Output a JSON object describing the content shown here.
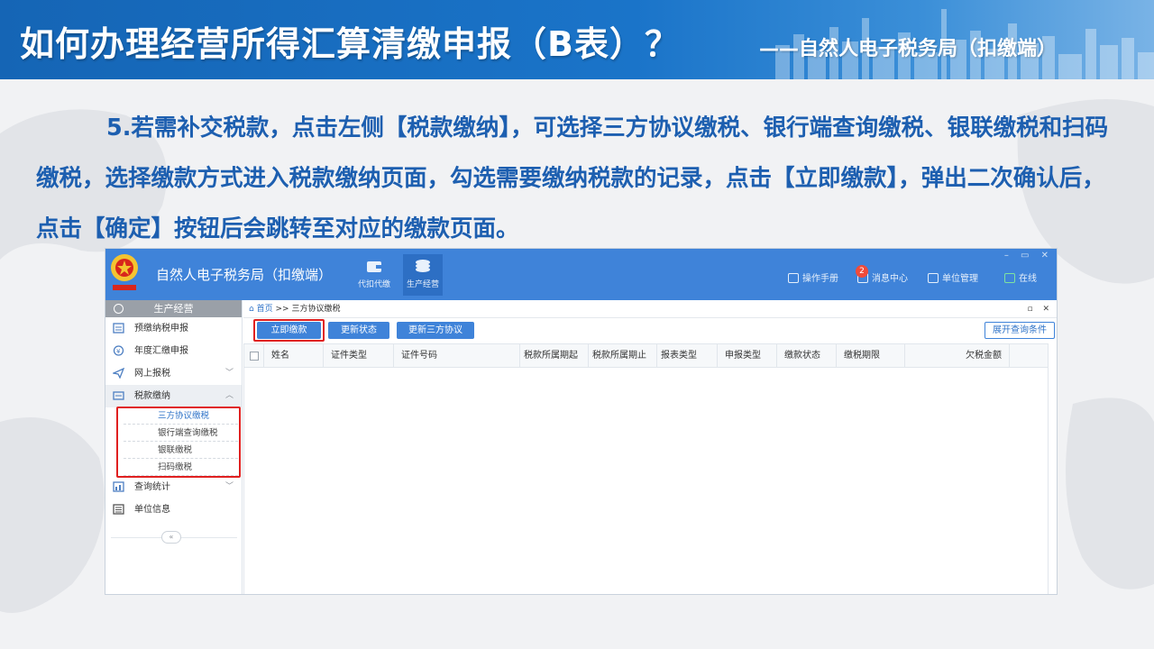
{
  "slide": {
    "title": "如何办理经营所得汇算清缴申报（B表）？",
    "subtitle": "——自然人电子税务局（扣缴端）",
    "instruction": "5.若需补交税款，点击左侧【税款缴纳】，可选择三方协议缴税、银行端查询缴税、银联缴税和扫码缴税，选择缴款方式进入税款缴纳页面，勾选需要缴纳税款的记录，点击【立即缴款】，弹出二次确认后，点击【确定】按钮后会跳转至对应的缴款页面。"
  },
  "app": {
    "name": "自然人电子税务局（扣缴端）",
    "top_nav": [
      {
        "label": "代扣代缴",
        "icon": "wallet-icon"
      },
      {
        "label": "生产经营",
        "icon": "coins-icon"
      }
    ],
    "top_right": {
      "manual": "操作手册",
      "messages": "消息中心",
      "message_count": "2",
      "unit_mgmt": "单位管理",
      "online": "在线"
    },
    "window_controls": "– ▭ ✕",
    "sidebar": {
      "header": "生产经营",
      "items": [
        {
          "label": "预缴纳税申报",
          "icon": "form-icon"
        },
        {
          "label": "年度汇缴申报",
          "icon": "yen-icon"
        },
        {
          "label": "网上报税",
          "icon": "send-icon",
          "chevron": "﹀"
        },
        {
          "label": "税款缴纳",
          "icon": "pay-icon",
          "chevron": "︿"
        }
      ],
      "submenu": [
        "三方协议缴税",
        "银行端查询缴税",
        "银联缴税",
        "扫码缴税"
      ],
      "items_after": [
        {
          "label": "查询统计",
          "icon": "chart-icon",
          "chevron": "﹀"
        },
        {
          "label": "单位信息",
          "icon": "list-icon"
        }
      ],
      "collapse": "«"
    },
    "breadcrumb": {
      "home": "首页",
      "sep": ">>",
      "current": "三方协议缴税",
      "controls": "▫ ✕"
    },
    "toolbar": {
      "pay_now": "立即缴款",
      "update_status": "更新状态",
      "update_agreement": "更新三方协议",
      "expand_query": "展开查询条件"
    },
    "table": {
      "columns": [
        "姓名",
        "证件类型",
        "证件号码",
        "税款所属期起",
        "税款所属期止",
        "报表类型",
        "申报类型",
        "缴款状态",
        "缴税期限",
        "欠税金额"
      ]
    },
    "colors": {
      "topbar": "#3f83d9",
      "accent": "#2f73c8",
      "highlight_box": "#e02020",
      "instruction_text": "#1d5fb0"
    }
  }
}
